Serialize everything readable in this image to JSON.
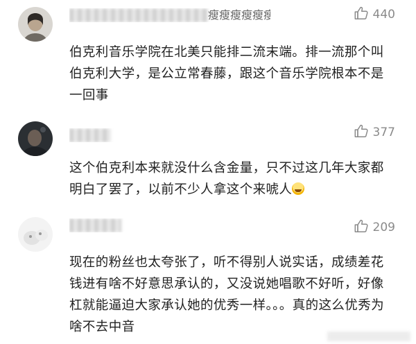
{
  "comments": [
    {
      "username_visible": "瘦瘦瘦瘦瘦瘦瘦瘦瘦瘦",
      "likes": "440",
      "text": "伯克利音乐学院在北美只能排二流末端。排一流那个叫伯克利大学，是公立常春藤，跟这个音乐学院根本不是一回事"
    },
    {
      "username_visible": "",
      "likes": "377",
      "text": "这个伯克利本来就没什么含金量，只不过这几年大家都明白了罢了，以前不少人拿这个来唬人"
    },
    {
      "username_visible": "",
      "likes": "209",
      "text": "现在的粉丝也太夸张了，听不得别人说实话，成绩差花钱进有啥不好意思承认的，又没说她唱歌不好听，好像杠就能逼迫大家承认她的优秀一样。。。真的这么优秀为啥不去中音"
    }
  ],
  "icons": {
    "like": "thumbs-up-icon"
  },
  "colors": {
    "text": "#222222",
    "meta": "#8a8a8a"
  }
}
